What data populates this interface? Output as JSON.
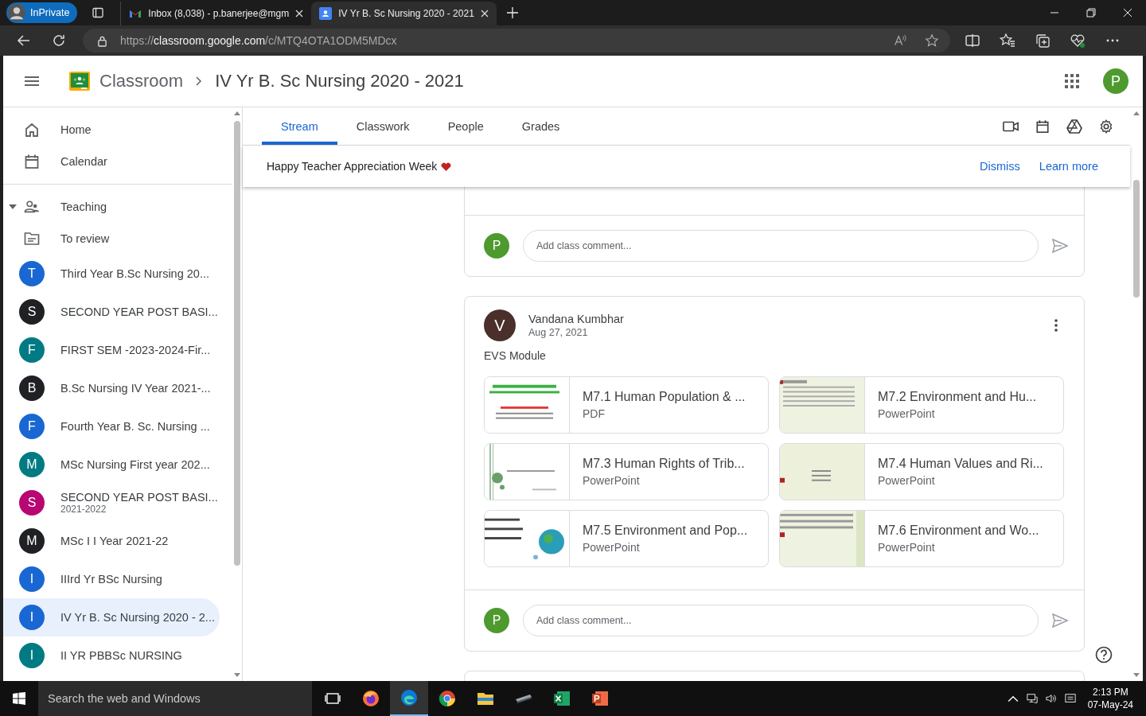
{
  "browser": {
    "profile": "InPrivate",
    "tabs": [
      {
        "title": "Inbox (8,038) - p.banerjee@mgm",
        "kind": "mail",
        "selected": false
      },
      {
        "title": "IV Yr B. Sc Nursing 2020 - 2021",
        "kind": "classroom",
        "selected": true
      }
    ],
    "url": {
      "scheme": "https://",
      "host": "classroom.google.com",
      "path": "/c/MTQ4OTA1ODM5MDcx"
    }
  },
  "header": {
    "app": "Classroom",
    "class_name": "IV Yr B. Sc Nursing 2020 - 2021",
    "avatar": "P"
  },
  "sidebar": {
    "items": [
      {
        "label": "Home",
        "kind": "home"
      },
      {
        "label": "Calendar",
        "kind": "calendar"
      }
    ],
    "section": {
      "label": "Teaching",
      "expanded": true
    },
    "review": "To review",
    "classes": [
      {
        "initial": "T",
        "name": "Third Year B.Sc Nursing 20...",
        "color": "#1967d2",
        "selected": false
      },
      {
        "initial": "S",
        "name": "SECOND YEAR POST BASI...",
        "color": "#202124",
        "selected": false
      },
      {
        "initial": "F",
        "name": "FIRST SEM -2023-2024-Fir...",
        "color": "#007b83",
        "selected": false
      },
      {
        "initial": "B",
        "name": "B.Sc Nursing IV Year 2021-...",
        "color": "#202124",
        "selected": false
      },
      {
        "initial": "F",
        "name": "Fourth Year B. Sc. Nursing ...",
        "color": "#1967d2",
        "selected": false
      },
      {
        "initial": "M",
        "name": "MSc Nursing First year 202...",
        "color": "#007b83",
        "selected": false
      },
      {
        "initial": "S",
        "name": "SECOND YEAR POST BASI...",
        "subtitle": "2021-2022",
        "color": "#b80672",
        "selected": false
      },
      {
        "initial": "M",
        "name": "MSc I I Year 2021-22",
        "color": "#202124",
        "selected": false
      },
      {
        "initial": "I",
        "name": "IIIrd Yr BSc Nursing",
        "color": "#1967d2",
        "selected": false
      },
      {
        "initial": "I",
        "name": "IV Yr B. Sc Nursing 2020 - 2...",
        "color": "#1967d2",
        "selected": true
      },
      {
        "initial": "I",
        "name": "II YR PBBSc NURSING",
        "color": "#007b83",
        "selected": false
      }
    ]
  },
  "tabs": [
    {
      "label": "Stream",
      "selected": true
    },
    {
      "label": "Classwork",
      "selected": false
    },
    {
      "label": "People",
      "selected": false
    },
    {
      "label": "Grades",
      "selected": false
    }
  ],
  "banner": {
    "text": "Happy Teacher Appreciation Week",
    "actions": [
      "Dismiss",
      "Learn more"
    ]
  },
  "posts": [
    {
      "comment_avatar": "P",
      "comment_placeholder": "Add class comment..."
    },
    {
      "author": "Vandana Kumbhar",
      "author_initial": "V",
      "date": "Aug 27, 2021",
      "text": "EVS Module",
      "attachments": [
        {
          "title": "M7.1 Human Population & ...",
          "type": "PDF"
        },
        {
          "title": "M7.2 Environment and Hu...",
          "type": "PowerPoint"
        },
        {
          "title": "M7.3 Human Rights of Trib...",
          "type": "PowerPoint"
        },
        {
          "title": "M7.4 Human Values and Ri...",
          "type": "PowerPoint"
        },
        {
          "title": "M7.5 Environment and Pop...",
          "type": "PowerPoint"
        },
        {
          "title": "M7.6 Environment and Wo...",
          "type": "PowerPoint"
        }
      ],
      "comment_avatar": "P",
      "comment_placeholder": "Add class comment..."
    }
  ],
  "taskbar": {
    "search_placeholder": "Search the web and Windows",
    "time": "2:13 PM",
    "date": "07-May-24"
  }
}
